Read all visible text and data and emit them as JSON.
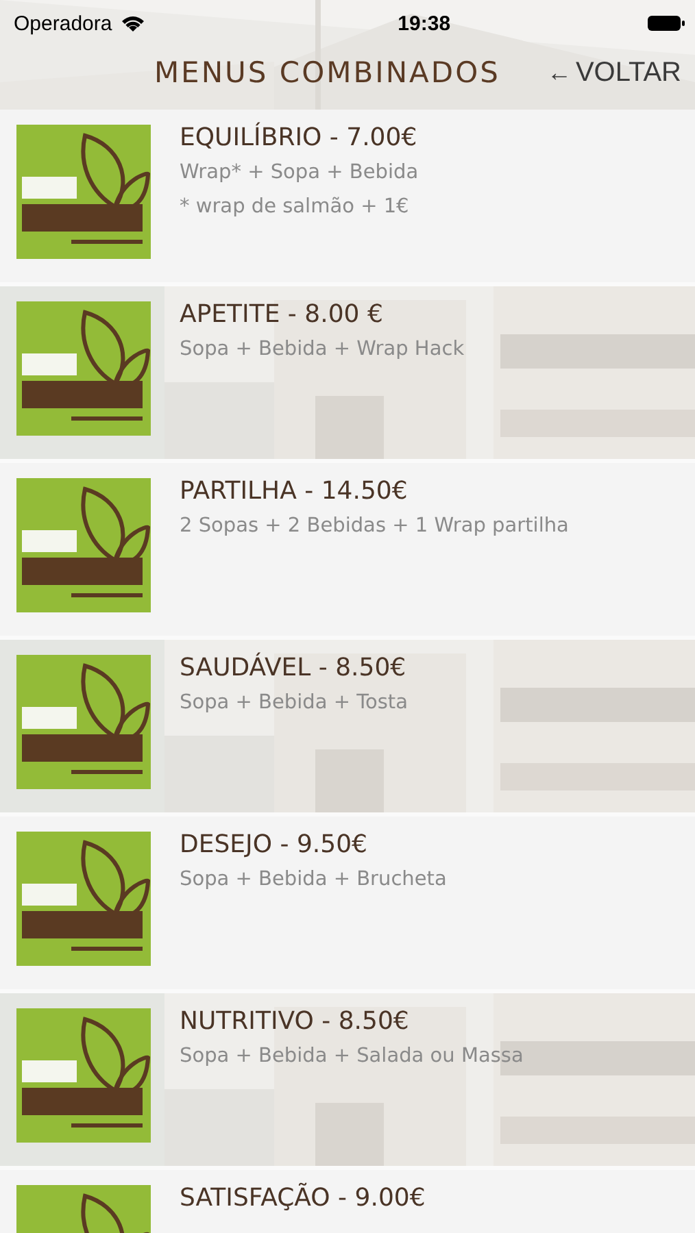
{
  "status_bar": {
    "carrier": "Operadora",
    "time": "19:38"
  },
  "header": {
    "title": "MENUS COMBINADOS",
    "back": {
      "arrow": "←",
      "label": "VOLTAR"
    }
  },
  "menus": [
    {
      "kind": "plain",
      "title": "EQUILÍBRIO - 7.00€",
      "lines": [
        "Wrap* + Sopa + Bebida",
        "* wrap de salmão + 1€"
      ]
    },
    {
      "title": "APETITE - 8.00 €",
      "lines": [
        "Sopa + Bebida + Wrap Hack"
      ]
    },
    {
      "kind": "plain",
      "title": "PARTILHA - 14.50€",
      "lines": [
        "2 Sopas + 2 Bebidas + 1 Wrap partilha"
      ]
    },
    {
      "title": "SAUDÁVEL - 8.50€",
      "lines": [
        "Sopa + Bebida + Tosta"
      ]
    },
    {
      "kind": "plain",
      "title": "DESEJO - 9.50€",
      "lines": [
        "Sopa + Bebida + Brucheta"
      ]
    },
    {
      "title": "NUTRITIVO - 8.50€",
      "lines": [
        "Sopa + Bebida + Salada ou Massa"
      ]
    },
    {
      "kind": "plain",
      "title": "SATISFAÇÃO - 9.00€"
    }
  ]
}
